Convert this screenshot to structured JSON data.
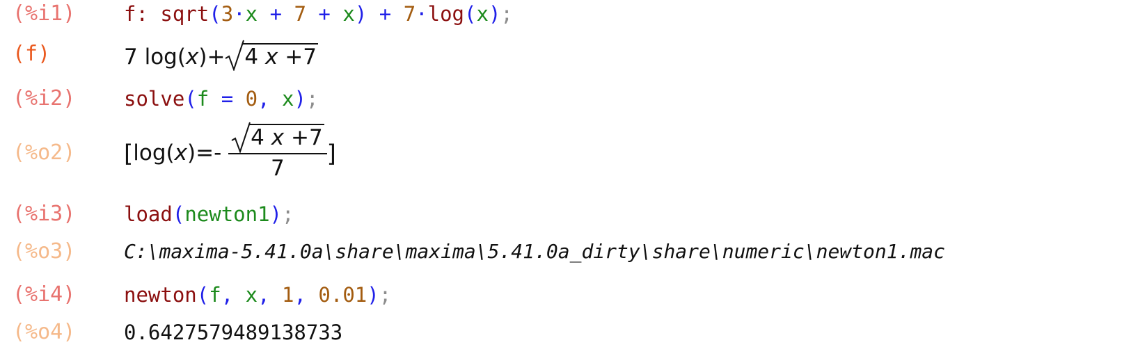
{
  "cells": [
    {
      "label": "(%i1)",
      "tokens": [
        "f: ",
        "sqrt",
        "(",
        "3",
        "·",
        "x",
        " + ",
        "7",
        " + ",
        "x",
        ")",
        " + ",
        "7",
        "·",
        "log",
        "(",
        "x",
        ")",
        ";"
      ]
    },
    {
      "label": "(f)",
      "math": {
        "coef": "7",
        "fn": "log",
        "open": "(",
        "arg": "x",
        "close": ")",
        "plus": "+",
        "radicand_a": "4",
        "radicand_x": "x",
        "radicand_plus": "+",
        "radicand_b": "7"
      }
    },
    {
      "label": "(%i2)",
      "tokens": [
        "solve",
        "(",
        "f",
        " = ",
        "0",
        ", ",
        "x",
        ")",
        ";"
      ]
    },
    {
      "label": "(%o2)",
      "math": {
        "lbracket": "[",
        "fn": "log",
        "open": "(",
        "arg": "x",
        "close": ")",
        "eq": "=",
        "minus": "-",
        "radicand_a": "4",
        "radicand_x": "x",
        "radicand_plus": "+",
        "radicand_b": "7",
        "denominator": "7",
        "rbracket": "]"
      }
    },
    {
      "label": "(%i3)",
      "tokens": [
        "load",
        "(",
        "newton1",
        ")",
        ";"
      ]
    },
    {
      "label": "(%o3)",
      "text": "C:\\maxima-5.41.0a\\share\\maxima\\5.41.0a_dirty\\share\\numeric\\newton1.mac"
    },
    {
      "label": "(%i4)",
      "tokens": [
        "newton",
        "(",
        "f",
        ", ",
        "x",
        ", ",
        "1",
        ", ",
        "0.01",
        ")",
        ";"
      ]
    },
    {
      "label": "(%o4)",
      "text": "0.6427579489138733"
    }
  ],
  "colors": {
    "input_label": "#e8736f",
    "output_label": "#f5b98a",
    "named_label": "#ea5a20",
    "function": "#8b0f0f",
    "variable": "#1c8a1c",
    "number": "#a35c10",
    "operator": "#2020e8",
    "semicolon": "#8c8c8c"
  }
}
